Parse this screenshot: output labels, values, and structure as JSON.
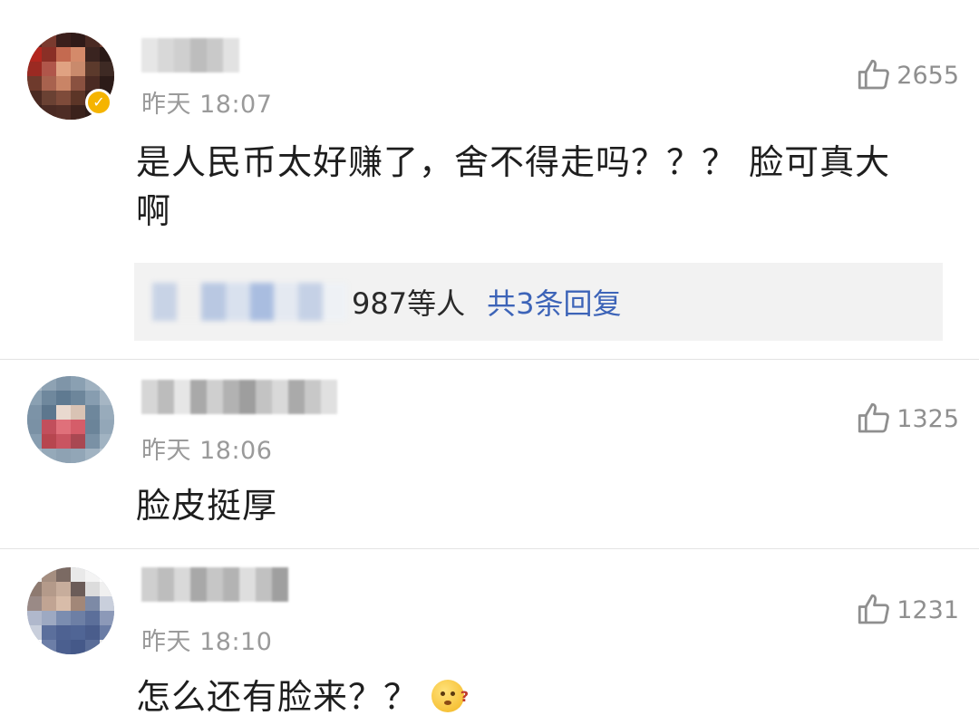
{
  "comments": [
    {
      "time": "昨天 18:07",
      "likes": "2655",
      "text": "是人民币太好赚了，舍不得走吗？？？ 脸可真大啊",
      "verified": true,
      "replies": {
        "visible_fragment": "987等人",
        "total": "共3条回复"
      }
    },
    {
      "time": "昨天 18:06",
      "likes": "1325",
      "text": "脸皮挺厚"
    },
    {
      "time": "昨天 18:10",
      "likes": "1231",
      "text": "怎么还有脸来？？"
    }
  ],
  "colors": {
    "timestamp": "#9a9a9a",
    "reply_link": "#3d64b8",
    "reply_background": "#f2f2f2",
    "verified_badge": "#f5b400"
  },
  "icons": {
    "like": "thumbs-up-icon",
    "emoji": "puzzled-face-emoji"
  }
}
